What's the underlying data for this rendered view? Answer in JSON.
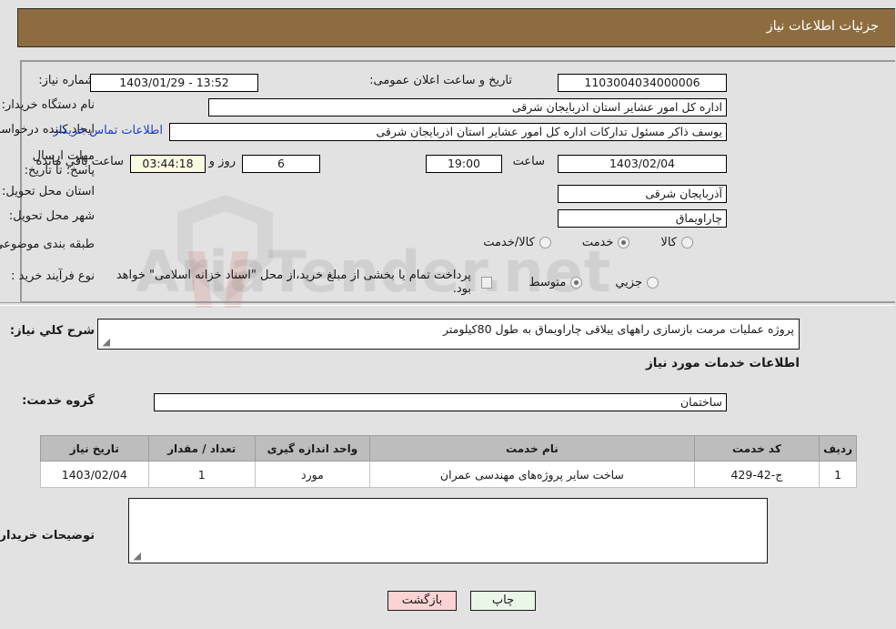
{
  "window": {
    "title": "جزئیات اطلاعات نیاز",
    "header_color": "#8d6d3f"
  },
  "watermark": {
    "text": "AriaTender.net"
  },
  "form": {
    "need_number": {
      "label": "شماره نیاز:",
      "value": "1103004034000006"
    },
    "announce_datetime": {
      "label": "تاریخ و ساعت اعلان عمومی:",
      "value": "13:52 - 1403/01/29"
    },
    "buyer_org": {
      "label": "نام دستگاه خریدار:",
      "value": "اداره کل امور عشایر استان اذربایجان شرقی"
    },
    "request_creator": {
      "label": "ایجاد کننده درخواست:",
      "value": "یوسف ذاکر مسئول تدارکات اداره کل امور عشایر استان اذربایجان شرقی"
    },
    "buyer_contact_link": {
      "label": "اطلاعات تماس خریدار"
    },
    "response_deadline": {
      "label": "مهلت ارسال پاسخ: تا تاریخ:",
      "date": "1403/02/04",
      "time_label": "ساعت",
      "time": "19:00",
      "days_remaining": "6",
      "days_label": "روز و",
      "countdown": "03:44:18",
      "countdown_label": "ساعت باقي مانده"
    },
    "delivery_province": {
      "label": "استان محل تحویل:",
      "value": "آذربایجان شرقی"
    },
    "delivery_city": {
      "label": "شهر محل تحویل:",
      "value": "چاراویماق"
    },
    "subject_category": {
      "label": "طبقه بندی موضوعی:",
      "options": [
        "کالا",
        "خدمت",
        "کالا/خدمت"
      ],
      "selected": "خدمت"
    },
    "purchase_process": {
      "label": "نوع فرآیند خرید :",
      "options": [
        "جزیي",
        "متوسط"
      ],
      "selected": "متوسط",
      "checkbox_label": "پرداخت تمام یا بخشی از مبلغ خرید،از محل \"اسناد خزانه اسلامی\" خواهد بود.",
      "checkbox_checked": false
    },
    "general_description": {
      "label": "شرح كلي نياز:",
      "value": "پروژه عملیات مرمت بازسازی راههای ییلاقی چاراویماق به طول 80کیلومتر"
    },
    "services_section_title": "اطلاعات خدمات مورد نیاز",
    "service_group": {
      "label": "گروه خدمت:",
      "value": "ساختمان"
    },
    "buyer_notes": {
      "label": "توضیحات خریدار:",
      "value": ""
    }
  },
  "table": {
    "columns": [
      "ردیف",
      "کد خدمت",
      "نام خدمت",
      "واحد اندازه گیری",
      "تعداد / مقدار",
      "تاریخ نیاز"
    ],
    "rows": [
      {
        "index": "1",
        "service_code": "ج-42-429",
        "service_name": "ساخت سایر پروژه‌های مهندسی عمران",
        "unit": "مورد",
        "quantity": "1",
        "need_date": "1403/02/04"
      }
    ]
  },
  "buttons": {
    "print": "چاپ",
    "back": "بازگشت"
  }
}
